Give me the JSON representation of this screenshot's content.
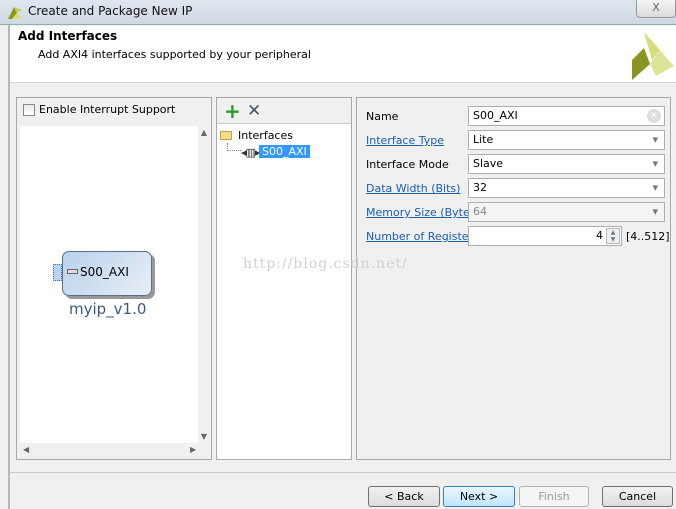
{
  "window": {
    "title": "Create and Package New IP",
    "close": "X"
  },
  "header": {
    "title": "Add Interfaces",
    "subtitle": "Add AXI4 interfaces supported by your peripheral"
  },
  "left": {
    "interrupt_label": "Enable Interrupt Support",
    "interrupt_checked": false,
    "block_port": "S00_AXI",
    "block_name": "myip_v1.0"
  },
  "tree": {
    "root": "Interfaces",
    "items": [
      {
        "label": "S00_AXI",
        "selected": true
      }
    ]
  },
  "props": {
    "name": {
      "label": "Name",
      "value": "S00_AXI"
    },
    "interface_type": {
      "label": "Interface Type",
      "value": "Lite"
    },
    "interface_mode": {
      "label": "Interface Mode",
      "value": "Slave"
    },
    "data_width": {
      "label": "Data Width (Bits)",
      "value": "32"
    },
    "memory_size": {
      "label": "Memory Size (Bytes)",
      "value": "64"
    },
    "num_registers": {
      "label": "Number of Registers",
      "value": "4",
      "range": "[4..512]"
    }
  },
  "watermark": "http://blog.csdn.net/",
  "buttons": {
    "back": "< Back",
    "next": "Next >",
    "finish": "Finish",
    "cancel": "Cancel"
  },
  "colors": {
    "link": "#1a5fb4",
    "selection": "#3399ff",
    "add_icon": "#2a9a2a"
  }
}
